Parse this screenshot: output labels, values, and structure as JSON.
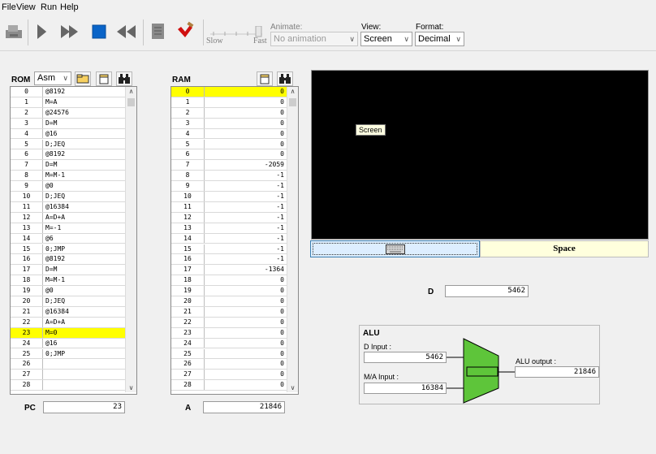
{
  "menu": {
    "items": [
      "File",
      "View",
      "Run",
      "Help"
    ]
  },
  "toolbar": {
    "speed_slow": "Slow",
    "speed_fast": "Fast",
    "animate_label": "Animate:",
    "animate_value": "No animation",
    "view_label": "View:",
    "view_value": "Screen",
    "format_label": "Format:",
    "format_value": "Decimal"
  },
  "rom": {
    "title": "ROM",
    "mode": "Asm",
    "highlight_row": 23,
    "rows": [
      {
        "addr": "0",
        "val": "@8192"
      },
      {
        "addr": "1",
        "val": "M=A"
      },
      {
        "addr": "2",
        "val": "@24576"
      },
      {
        "addr": "3",
        "val": "D=M"
      },
      {
        "addr": "4",
        "val": "@16"
      },
      {
        "addr": "5",
        "val": "D;JEQ"
      },
      {
        "addr": "6",
        "val": "@8192"
      },
      {
        "addr": "7",
        "val": "D=M"
      },
      {
        "addr": "8",
        "val": "M=M-1"
      },
      {
        "addr": "9",
        "val": "@0"
      },
      {
        "addr": "10",
        "val": "D;JEQ"
      },
      {
        "addr": "11",
        "val": "@16384"
      },
      {
        "addr": "12",
        "val": "A=D+A"
      },
      {
        "addr": "13",
        "val": "M=-1"
      },
      {
        "addr": "14",
        "val": "@6"
      },
      {
        "addr": "15",
        "val": "0;JMP"
      },
      {
        "addr": "16",
        "val": "@8192"
      },
      {
        "addr": "17",
        "val": "D=M"
      },
      {
        "addr": "18",
        "val": "M=M-1"
      },
      {
        "addr": "19",
        "val": "@0"
      },
      {
        "addr": "20",
        "val": "D;JEQ"
      },
      {
        "addr": "21",
        "val": "@16384"
      },
      {
        "addr": "22",
        "val": "A=D+A"
      },
      {
        "addr": "23",
        "val": "M=0"
      },
      {
        "addr": "24",
        "val": "@16"
      },
      {
        "addr": "25",
        "val": "0;JMP"
      },
      {
        "addr": "26",
        "val": ""
      },
      {
        "addr": "27",
        "val": ""
      },
      {
        "addr": "28",
        "val": ""
      }
    ]
  },
  "ram": {
    "title": "RAM",
    "highlight_row": 0,
    "rows": [
      {
        "addr": "0",
        "val": "0"
      },
      {
        "addr": "1",
        "val": "0"
      },
      {
        "addr": "2",
        "val": "0"
      },
      {
        "addr": "3",
        "val": "0"
      },
      {
        "addr": "4",
        "val": "0"
      },
      {
        "addr": "5",
        "val": "0"
      },
      {
        "addr": "6",
        "val": "0"
      },
      {
        "addr": "7",
        "val": "-2059"
      },
      {
        "addr": "8",
        "val": "-1"
      },
      {
        "addr": "9",
        "val": "-1"
      },
      {
        "addr": "10",
        "val": "-1"
      },
      {
        "addr": "11",
        "val": "-1"
      },
      {
        "addr": "12",
        "val": "-1"
      },
      {
        "addr": "13",
        "val": "-1"
      },
      {
        "addr": "14",
        "val": "-1"
      },
      {
        "addr": "15",
        "val": "-1"
      },
      {
        "addr": "16",
        "val": "-1"
      },
      {
        "addr": "17",
        "val": "-1364"
      },
      {
        "addr": "18",
        "val": "0"
      },
      {
        "addr": "19",
        "val": "0"
      },
      {
        "addr": "20",
        "val": "0"
      },
      {
        "addr": "21",
        "val": "0"
      },
      {
        "addr": "22",
        "val": "0"
      },
      {
        "addr": "23",
        "val": "0"
      },
      {
        "addr": "24",
        "val": "0"
      },
      {
        "addr": "25",
        "val": "0"
      },
      {
        "addr": "26",
        "val": "0"
      },
      {
        "addr": "27",
        "val": "0"
      },
      {
        "addr": "28",
        "val": "0"
      }
    ]
  },
  "pc": {
    "label": "PC",
    "value": "23"
  },
  "a_reg": {
    "label": "A",
    "value": "21846"
  },
  "d_reg": {
    "label": "D",
    "value": "5462"
  },
  "screen": {
    "tooltip": "Screen"
  },
  "keyboard": {
    "key": "Space"
  },
  "alu": {
    "title": "ALU",
    "d_input_label": "D Input :",
    "d_input": "5462",
    "ma_input_label": "M/A Input :",
    "ma_input": "16384",
    "output_label": "ALU output :",
    "output": "21846"
  },
  "colors": {
    "highlight": "#ffff00",
    "alu_fill": "#5ec53a",
    "screen_bg": "#000000",
    "key_bg": "#ffffdd"
  },
  "icons": [
    "load-program-icon",
    "single-step-icon",
    "fast-forward-icon",
    "stop-icon",
    "rewind-icon",
    "script-icon",
    "breakpoint-icon",
    "open-file-icon",
    "new-file-icon",
    "find-icon"
  ]
}
